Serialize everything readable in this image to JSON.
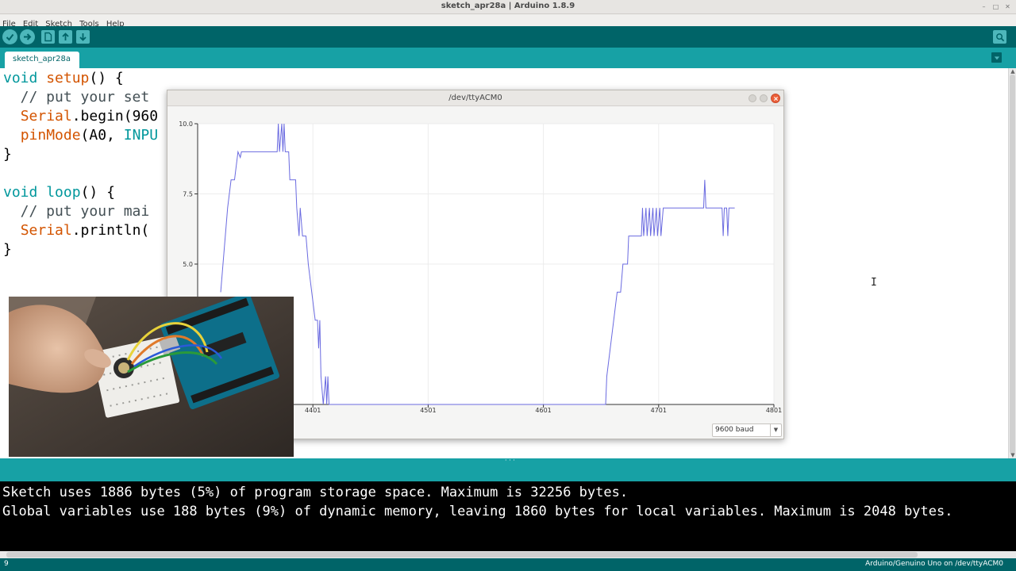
{
  "window": {
    "title": "sketch_apr28a | Arduino 1.8.9"
  },
  "menu": {
    "items": [
      "File",
      "Edit",
      "Sketch",
      "Tools",
      "Help"
    ]
  },
  "toolbar": {
    "buttons": [
      "verify-icon",
      "upload-icon",
      "new-icon",
      "open-icon",
      "save-icon"
    ],
    "serial_monitor_icon": "magnifier-icon"
  },
  "tabs": {
    "active": "sketch_apr28a"
  },
  "editor": {
    "lines": {
      "l1_kw": "void",
      "l1_fn": "setup",
      "l1_rest": "() {",
      "l2": "  // put your set",
      "l3_obj": "Serial",
      "l3_rest": ".begin(960",
      "l4_fn": "pinMode",
      "l4_args": "(A0, ",
      "l4_const": "INPU",
      "l5": "}",
      "l7_kw": "void",
      "l7_fn": "loop",
      "l7_rest": "() {",
      "l8": "  // put your mai",
      "l9_obj": "Serial",
      "l9_rest": ".println(",
      "l10": "}"
    }
  },
  "plotter": {
    "title": "/dev/ttyACM0",
    "baud": "9600 baud"
  },
  "chart_data": {
    "type": "line",
    "title": "",
    "xlabel": "",
    "ylabel": "",
    "xlim": [
      4301,
      4801
    ],
    "ylim": [
      0,
      10.0
    ],
    "y_ticks": [
      "10.0",
      "7.5",
      "5.0"
    ],
    "x_ticks": [
      "4401",
      "4501",
      "4601",
      "4701",
      "4801"
    ],
    "series": [
      {
        "color": "#6a6ae0",
        "points": [
          [
            4321,
            4.0
          ],
          [
            4323,
            5.0
          ],
          [
            4325,
            6.0
          ],
          [
            4327,
            7.0
          ],
          [
            4330,
            8.0
          ],
          [
            4333,
            8.0
          ],
          [
            4336,
            9.0
          ],
          [
            4338,
            8.8
          ],
          [
            4339,
            9.0
          ],
          [
            4342,
            9.0
          ],
          [
            4370,
            9.0
          ],
          [
            4371,
            10.0
          ],
          [
            4372,
            9.0
          ],
          [
            4374,
            10.0
          ],
          [
            4375,
            9.0
          ],
          [
            4376,
            10.0
          ],
          [
            4377,
            9.0
          ],
          [
            4380,
            9.0
          ],
          [
            4381,
            8.0
          ],
          [
            4386,
            8.0
          ],
          [
            4387,
            7.0
          ],
          [
            4389,
            6.0
          ],
          [
            4390,
            7.0
          ],
          [
            4392,
            6.0
          ],
          [
            4395,
            6.0
          ],
          [
            4397,
            5.0
          ],
          [
            4400,
            4.0
          ],
          [
            4403,
            3.0
          ],
          [
            4405,
            3.0
          ],
          [
            4406,
            2.0
          ],
          [
            4407,
            3.0
          ],
          [
            4408,
            1.0
          ],
          [
            4410,
            0.0
          ],
          [
            4412,
            1.0
          ],
          [
            4413,
            0.0
          ],
          [
            4414,
            1.0
          ],
          [
            4415,
            0.0
          ],
          [
            4655,
            0.0
          ],
          [
            4656,
            1.0
          ],
          [
            4659,
            2.0
          ],
          [
            4662,
            3.0
          ],
          [
            4665,
            4.0
          ],
          [
            4668,
            4.0
          ],
          [
            4670,
            5.0
          ],
          [
            4674,
            5.0
          ],
          [
            4675,
            6.0
          ],
          [
            4686,
            6.0
          ],
          [
            4687,
            7.0
          ],
          [
            4688,
            6.0
          ],
          [
            4690,
            7.0
          ],
          [
            4691,
            6.0
          ],
          [
            4693,
            7.0
          ],
          [
            4694,
            6.0
          ],
          [
            4696,
            7.0
          ],
          [
            4697,
            6.0
          ],
          [
            4699,
            7.0
          ],
          [
            4700,
            6.0
          ],
          [
            4702,
            7.0
          ],
          [
            4703,
            6.0
          ],
          [
            4705,
            7.0
          ],
          [
            4740,
            7.0
          ],
          [
            4741,
            8.0
          ],
          [
            4742,
            7.0
          ],
          [
            4756,
            7.0
          ],
          [
            4757,
            6.0
          ],
          [
            4758,
            7.0
          ],
          [
            4760,
            7.0
          ],
          [
            4761,
            6.0
          ],
          [
            4762,
            7.0
          ],
          [
            4767,
            7.0
          ]
        ]
      }
    ]
  },
  "console": {
    "line1": "Sketch uses 1886 bytes (5%) of program storage space. Maximum is 32256 bytes.",
    "line2": "Global variables use 188 bytes (9%) of dynamic memory, leaving 1860 bytes for local variables. Maximum is 2048 bytes."
  },
  "status": {
    "line_number": "9",
    "board": "Arduino/Genuino Uno on /dev/ttyACM0"
  },
  "colors": {
    "teal_dark": "#006468",
    "teal_mid": "#17a1a5",
    "teal_button": "#4db7bb",
    "plot_line": "#6a6ae0"
  }
}
